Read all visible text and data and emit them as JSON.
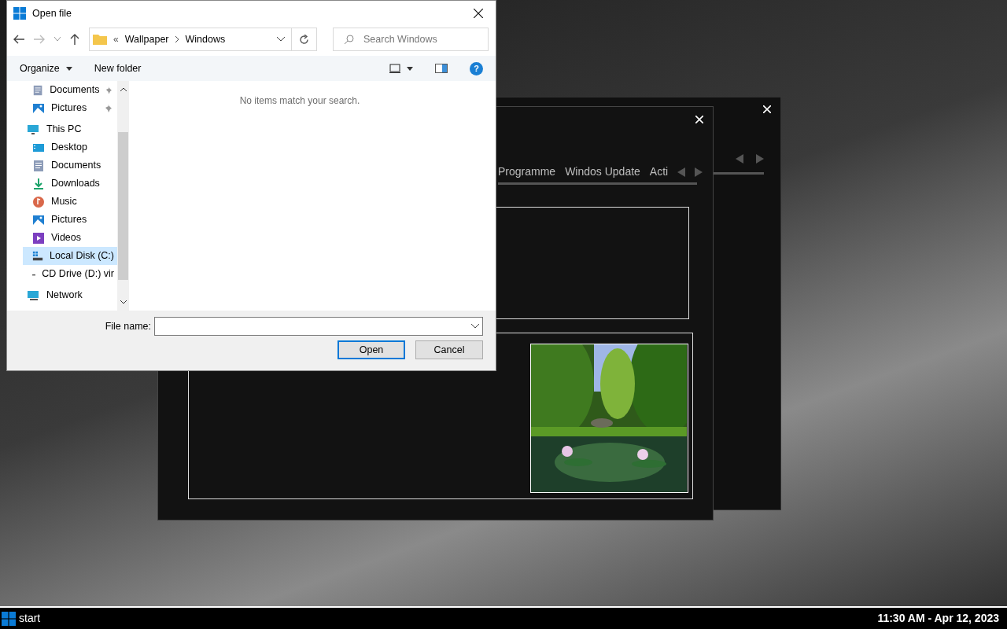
{
  "dialog": {
    "title": "Open file",
    "path": {
      "overflow": "«",
      "crumbs": [
        "Wallpaper",
        "Windows"
      ]
    },
    "search": {
      "placeholder": "Search Windows"
    },
    "toolbar": {
      "organize": "Organize",
      "new_folder": "New folder",
      "help": "?"
    },
    "sidebar": [
      {
        "label": "Documents",
        "kind": "documents",
        "pinned": true,
        "selected": false
      },
      {
        "label": "Pictures",
        "kind": "pictures",
        "pinned": true,
        "selected": false
      },
      {
        "label": "This PC",
        "kind": "pc",
        "pinned": false,
        "selected": false,
        "children": [
          {
            "label": "Desktop",
            "kind": "desktop",
            "selected": false
          },
          {
            "label": "Documents",
            "kind": "documents",
            "selected": false
          },
          {
            "label": "Downloads",
            "kind": "downloads",
            "selected": false
          },
          {
            "label": "Music",
            "kind": "music",
            "selected": false
          },
          {
            "label": "Pictures",
            "kind": "pictures",
            "selected": false
          },
          {
            "label": "Videos",
            "kind": "videos",
            "selected": false
          },
          {
            "label": "Local Disk (C:)",
            "kind": "disk",
            "selected": true
          },
          {
            "label": "CD Drive (D:) vir",
            "kind": "cd",
            "selected": false
          }
        ]
      },
      {
        "label": "Network",
        "kind": "network",
        "pinned": false,
        "selected": false
      }
    ],
    "empty_message": "No items match your search.",
    "file_name_label": "File name:",
    "buttons": [
      {
        "label": "Open",
        "default": true
      },
      {
        "label": "Cancel",
        "default": false
      }
    ]
  },
  "back_window": {
    "tabs": [
      "Programme",
      "Windos Update",
      "Acti"
    ]
  },
  "taskbar": {
    "start": "start",
    "clock": "11:30 AM - Apr 12, 2023"
  }
}
